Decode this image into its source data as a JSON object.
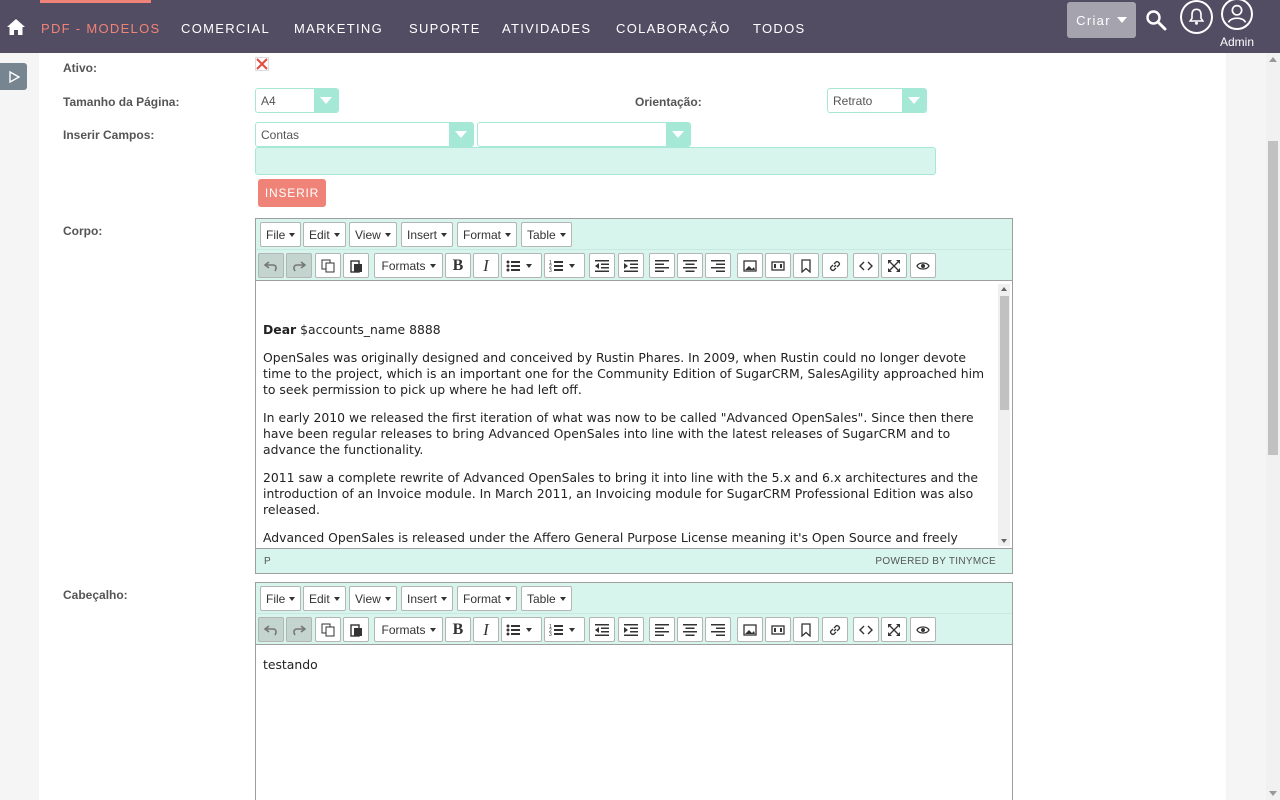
{
  "nav": {
    "items": [
      "PDF - MODELOS",
      "COMERCIAL",
      "MARKETING",
      "SUPORTE",
      "ATIVIDADES",
      "COLABORAÇÃO",
      "TODOS"
    ],
    "active_index": 0,
    "criar_label": "Criar",
    "admin_label": "Admin",
    "bar_color": "#534d64",
    "accent_color": "#f08377"
  },
  "form": {
    "ativo_label": "Ativo:",
    "tamanho_label": "Tamanho da Página:",
    "tamanho_value": "A4",
    "orientacao_label": "Orientação:",
    "orientacao_value": "Retrato",
    "inserir_campos_label": "Inserir Campos:",
    "module_value": "Contas",
    "field_value": "",
    "field_input_value": "",
    "inserir_button": "INSERIR",
    "corpo_label": "Corpo:",
    "cabecalho_label": "Cabeçalho:"
  },
  "editor": {
    "menus": [
      "File",
      "Edit",
      "View",
      "Insert",
      "Format",
      "Table"
    ],
    "formats_label": "Formats",
    "body": {
      "greeting_bold": "Dear",
      "greeting_rest": " $accounts_name 8888",
      "paragraphs": [
        "OpenSales was originally designed and conceived by Rustin Phares. In 2009, when Rustin could no longer devote time to the project, which is an important one for the Community Edition of SugarCRM, SalesAgility approached him to seek permission to pick up where he had left off.",
        "In early 2010 we released the first iteration of what was now to be called \"Advanced OpenSales\". Since then there have been regular releases to bring Advanced OpenSales into line with the latest releases of SugarCRM and to advance the functionality.",
        "2011 saw a complete rewrite of Advanced OpenSales to bring it into line with the 5.x and 6.x architectures and the introduction of an Invoice module. In March 2011, an Invoicing module for SugarCRM Professional Edition was also released.",
        "Advanced OpenSales is released under the Affero General Purpose License meaning it's Open Source and freely"
      ],
      "status_path": "P",
      "powered_by": "POWERED BY TINYMCE"
    },
    "header": {
      "text": "testando"
    }
  },
  "icons": {
    "home": "home-icon",
    "search": "search-icon",
    "notifications": "bell-icon",
    "user": "user-icon",
    "sidebar_toggle": "play-triangle-icon",
    "checkbox": "x-mark-icon"
  }
}
